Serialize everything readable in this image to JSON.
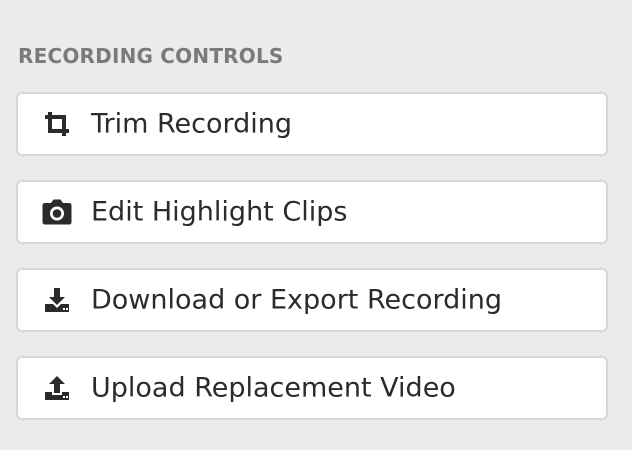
{
  "section": {
    "title": "RECORDING CONTROLS"
  },
  "controls": [
    {
      "label": "Trim Recording",
      "icon": "crop-icon"
    },
    {
      "label": "Edit Highlight Clips",
      "icon": "camera-icon"
    },
    {
      "label": "Download or Export Recording",
      "icon": "download-icon"
    },
    {
      "label": "Upload Replacement Video",
      "icon": "upload-icon"
    }
  ],
  "colors": {
    "background": "#ebebeb",
    "button_bg": "#ffffff",
    "button_border": "#d6d6d6",
    "title": "#7a7a7a",
    "label": "#2b2b2b",
    "icon": "#2b2b2b"
  }
}
